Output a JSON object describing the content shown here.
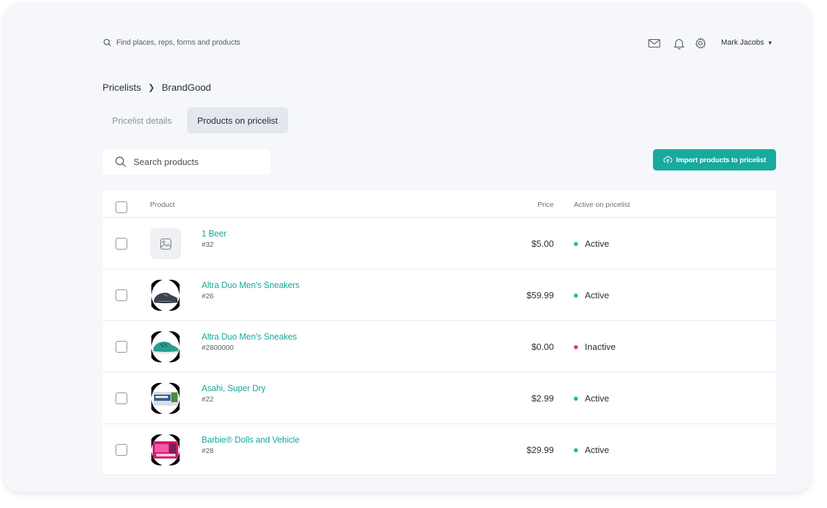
{
  "topbar": {
    "search_placeholder": "Find places, reps, forms and products",
    "icons": [
      "mail-icon",
      "bell-icon",
      "gear-icon"
    ],
    "user_name": "Mark Jacobs"
  },
  "breadcrumb": {
    "root": "Pricelists",
    "current": "BrandGood"
  },
  "tabs": [
    {
      "label": "Pricelist details",
      "active": false
    },
    {
      "label": "Products on pricelist",
      "active": true
    }
  ],
  "search": {
    "placeholder": "Search products"
  },
  "import_button": {
    "label": "Import products to pricelist"
  },
  "table": {
    "columns": {
      "product": "Product",
      "price": "Price",
      "active": "Active on pricelist"
    },
    "rows": [
      {
        "name": "1 Beer",
        "sku": "#32",
        "price": "$5.00",
        "status": "Active",
        "image": "placeholder-image-icon"
      },
      {
        "name": "Altra Duo Men's Sneakers",
        "sku": "#26",
        "price": "$59.99",
        "status": "Active",
        "image": "sneaker-photo"
      },
      {
        "name": "Altra Duo Men's Sneakes",
        "sku": "#2800000",
        "price": "$0.00",
        "status": "Inactive",
        "image": "sneaker-photo"
      },
      {
        "name": "Asahi, Super Dry",
        "sku": "#22",
        "price": "$2.99",
        "status": "Active",
        "image": "beer-pack-photo"
      },
      {
        "name": "Barbie® Dolls and Vehicle",
        "sku": "#28",
        "price": "$29.99",
        "status": "Active",
        "image": "toy-box-photo"
      }
    ]
  },
  "colors": {
    "accent": "#17aa9e",
    "active_dot": "#1fbf8f",
    "inactive_dot": "#e8404a",
    "background": "#f5f7fb"
  }
}
